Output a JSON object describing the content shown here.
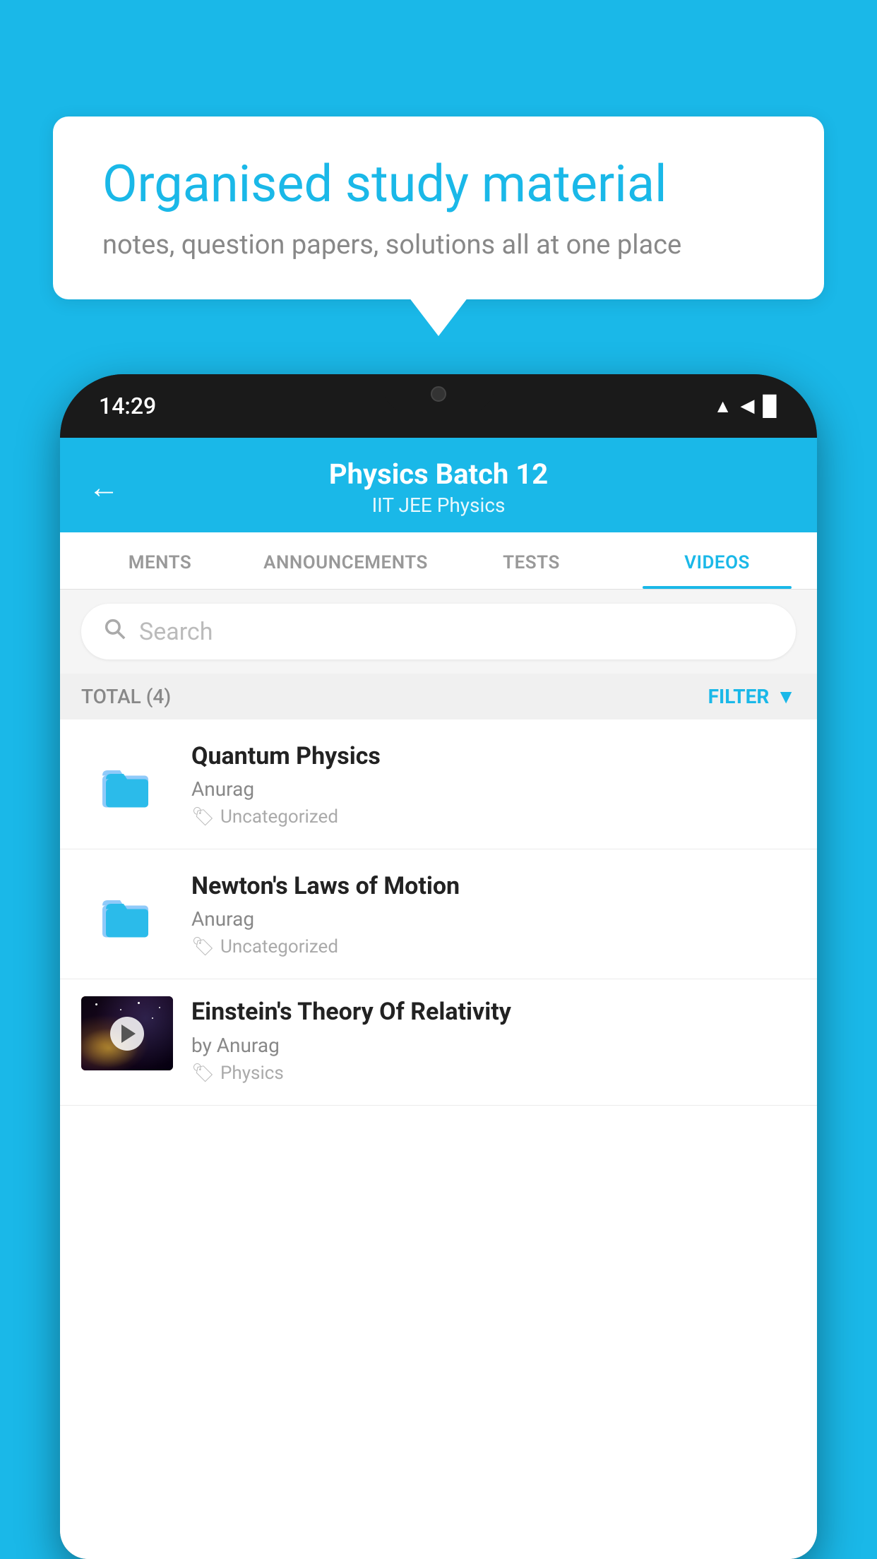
{
  "background_color": "#1ab8e8",
  "hero": {
    "title": "Organised study material",
    "subtitle": "notes, question papers, solutions all at one place"
  },
  "phone": {
    "status_bar": {
      "time": "14:29",
      "wifi": "▲",
      "signal": "▲",
      "battery": "▉"
    },
    "header": {
      "title": "Physics Batch 12",
      "subtitle_tags": "IIT JEE   Physics",
      "back_label": "←"
    },
    "tabs": [
      {
        "label": "MENTS",
        "active": false
      },
      {
        "label": "ANNOUNCEMENTS",
        "active": false
      },
      {
        "label": "TESTS",
        "active": false
      },
      {
        "label": "VIDEOS",
        "active": true
      }
    ],
    "search": {
      "placeholder": "Search"
    },
    "filter": {
      "total_label": "TOTAL (4)",
      "filter_label": "FILTER"
    },
    "videos": [
      {
        "id": 1,
        "title": "Quantum Physics",
        "author": "Anurag",
        "tag": "Uncategorized",
        "has_thumb": false
      },
      {
        "id": 2,
        "title": "Newton's Laws of Motion",
        "author": "Anurag",
        "tag": "Uncategorized",
        "has_thumb": false
      },
      {
        "id": 3,
        "title": "Einstein's Theory Of Relativity",
        "author": "by Anurag",
        "tag": "Physics",
        "has_thumb": true
      }
    ]
  }
}
